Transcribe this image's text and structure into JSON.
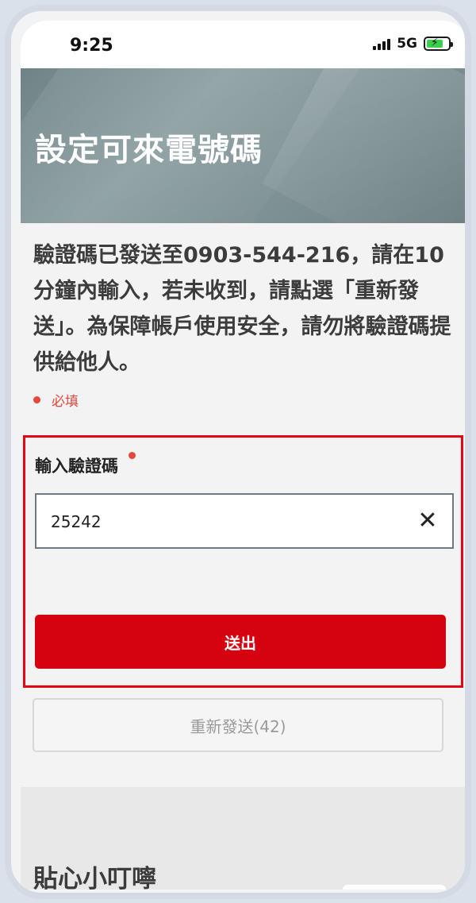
{
  "status_bar": {
    "time": "9:25",
    "network": "5G"
  },
  "header": {
    "title": "設定可來電號碼"
  },
  "message": {
    "text": "驗證碼已發送至0903-544-216，請在10分鐘內輸入，若未收到，請點選「重新發送」。為保障帳戶使用安全，請勿將驗證碼提供給他人。"
  },
  "required_note": "必填",
  "form": {
    "field_label": "輸入驗證碼",
    "input_value": "25242",
    "clear_symbol": "✕",
    "submit_label": "送出"
  },
  "resend": {
    "label": "重新發送(42)"
  },
  "tips": {
    "title": "貼心小叮嚀"
  },
  "colors": {
    "accent": "#d5020f",
    "highlight_border": "#e30613",
    "required": "#e4473b"
  }
}
